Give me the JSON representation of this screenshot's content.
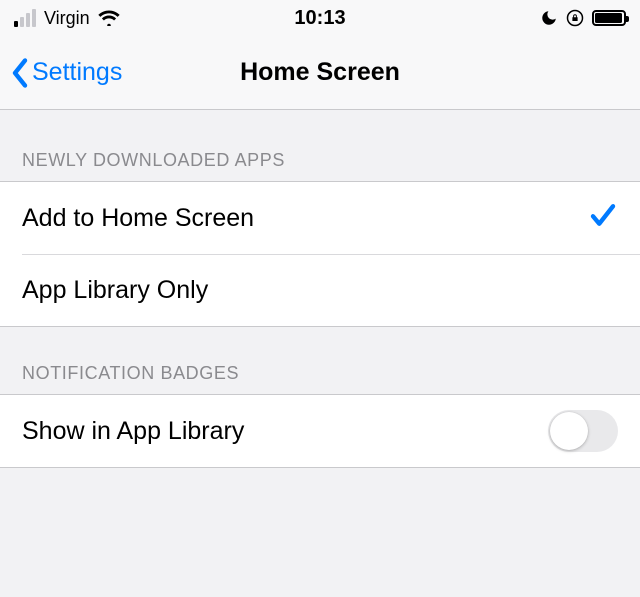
{
  "status_bar": {
    "carrier": "Virgin",
    "time": "10:13"
  },
  "nav": {
    "back_label": "Settings",
    "title": "Home Screen"
  },
  "sections": {
    "newly_downloaded": {
      "header": "NEWLY DOWNLOADED APPS",
      "options": {
        "add_home": "Add to Home Screen",
        "app_library_only": "App Library Only"
      },
      "selected": "add_home"
    },
    "notification_badges": {
      "header": "NOTIFICATION BADGES",
      "row_label": "Show in App Library",
      "enabled": false
    }
  }
}
